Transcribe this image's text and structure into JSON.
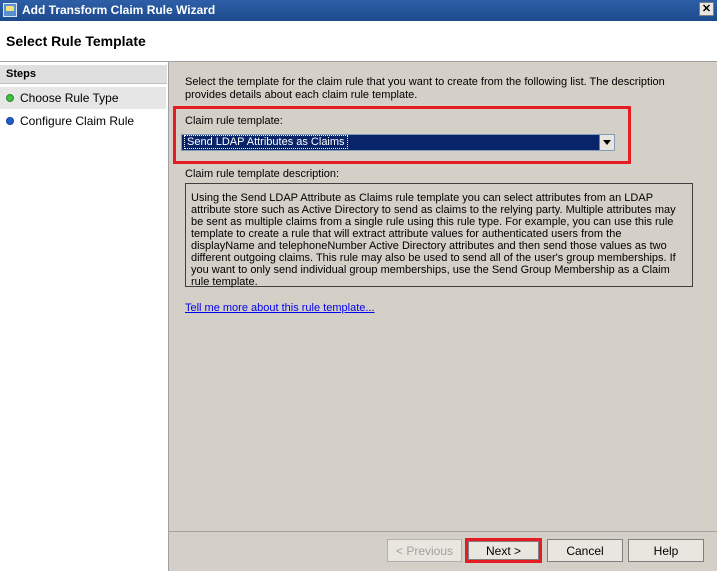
{
  "window": {
    "title": "Add Transform Claim Rule Wizard",
    "close_glyph": "✕"
  },
  "header": {
    "title": "Select Rule Template"
  },
  "steps": {
    "heading": "Steps",
    "items": [
      {
        "label": "Choose Rule Type",
        "status_color": "#3fbf3f",
        "active": true
      },
      {
        "label": "Configure Claim Rule",
        "status_color": "#1f5fd6",
        "active": false
      }
    ]
  },
  "main": {
    "intro": "Select the template for the claim rule that you want to create from the following list. The description provides details about each claim rule template.",
    "template_label": "Claim rule template:",
    "template_selected": "Send LDAP Attributes as Claims",
    "description_label": "Claim rule template description:",
    "description": "Using the Send LDAP Attribute as Claims rule template you can select attributes from an LDAP attribute store such as Active Directory to send as claims to the relying party. Multiple attributes may be sent as multiple claims from a single rule using this rule type. For example, you can use this rule template to create a rule that will extract attribute values for authenticated users from the displayName and telephoneNumber Active Directory attributes and then send those values as two different outgoing claims. This rule may also be used to send all of the user's group memberships. If you want to only send individual group memberships, use the Send Group Membership as a Claim rule template.",
    "help_link": "Tell me more about this rule template..."
  },
  "footer": {
    "previous": "< Previous",
    "next": "Next >",
    "cancel": "Cancel",
    "help": "Help"
  },
  "colors": {
    "highlight_red": "#e51c23",
    "selection_blue": "#0a246a",
    "link_blue": "#0000ee"
  }
}
